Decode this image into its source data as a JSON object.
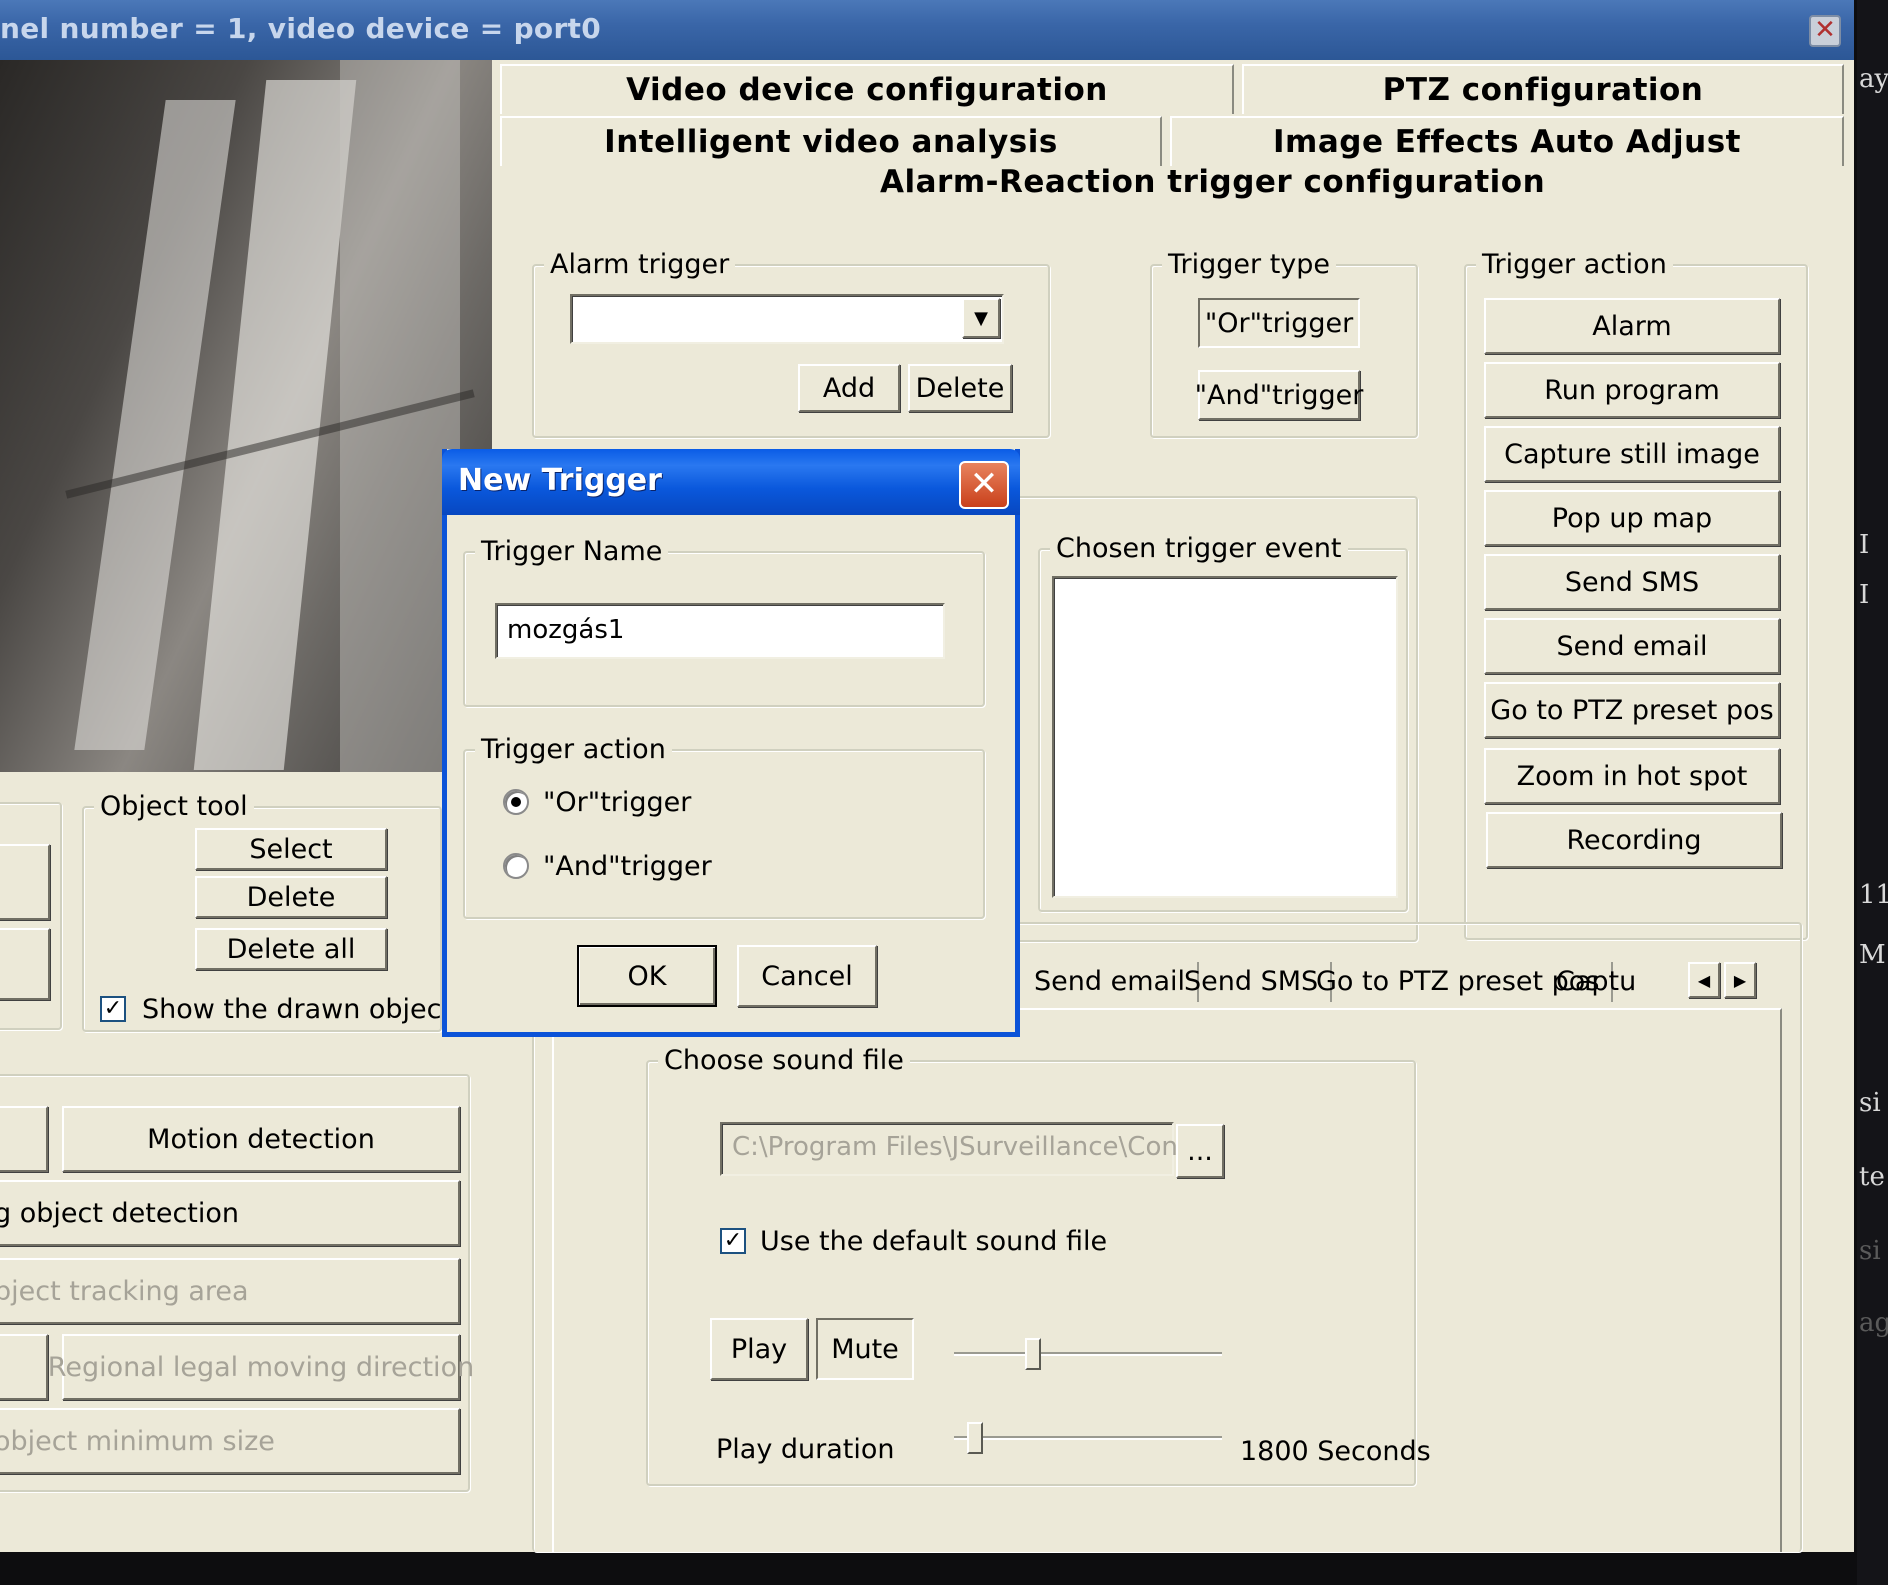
{
  "window": {
    "title": "nel number = 1, video device = port0",
    "close_glyph": "✕"
  },
  "right_strip": {
    "fragments": [
      "ay",
      "I",
      "I",
      "11",
      "M",
      "si",
      "te",
      "si",
      "ag"
    ]
  },
  "object_tool": {
    "legend": "Object tool",
    "select": "Select",
    "delete": "Delete",
    "delete_all": "Delete all",
    "show_drawn": "Show the drawn object",
    "show_drawn_checked": true
  },
  "left_actions": {
    "motion_detection": "Motion detection",
    "object_detection": "g object detection",
    "tracking_area": "bject tracking area",
    "regional_direction": "Regional legal moving direction",
    "min_size": "object minimum size"
  },
  "tabs": {
    "video_device": "Video device configuration",
    "ptz": "PTZ configuration",
    "intelligent": "Intelligent video analysis",
    "image_effects": "Image Effects Auto Adjust",
    "alarm_reaction": "Alarm-Reaction trigger configuration"
  },
  "alarm_trigger": {
    "legend": "Alarm trigger",
    "value": "",
    "add": "Add",
    "delete": "Delete"
  },
  "trigger_type": {
    "legend": "Trigger type",
    "or_trigger": "\"Or\"trigger",
    "and_trigger": "\"And\"trigger"
  },
  "trigger_action_panel": {
    "legend": "Trigger action",
    "buttons": [
      "Alarm",
      "Run program",
      "Capture still image",
      "Pop up map",
      "Send SMS",
      "Send email",
      "Go to PTZ preset pos",
      "Zoom in hot spot",
      "Recording"
    ]
  },
  "chosen_event": {
    "legend": "Chosen trigger event"
  },
  "action_tabs": {
    "items": [
      "Send email",
      "Send SMS",
      "Go to PTZ preset pos",
      "Captu"
    ],
    "left_arrow": "◀",
    "right_arrow": "▶"
  },
  "sound": {
    "legend": "Choose sound file",
    "path": "C:\\Program Files\\JSurveillance\\Conf",
    "browse": "...",
    "use_default": "Use the default sound file",
    "use_default_checked": true,
    "play": "Play",
    "mute": "Mute",
    "volume_level": 0.28,
    "play_duration_label": "Play duration",
    "play_duration_value": "1800 Seconds",
    "duration_level": 0.05
  },
  "dialog": {
    "title": "New Trigger",
    "close_glyph": "✕",
    "name_legend": "Trigger Name",
    "name_value": "mozgás1",
    "action_legend": "Trigger action",
    "or_trigger": "\"Or\"trigger",
    "and_trigger": "\"And\"trigger",
    "selected": "or",
    "ok": "OK",
    "cancel": "Cancel"
  },
  "colors": {
    "window_bg": "#ece9d8",
    "titlebar": "#3a66a8",
    "dialog_titlebar": "#0a58dc",
    "dialog_close": "#d9552d"
  }
}
